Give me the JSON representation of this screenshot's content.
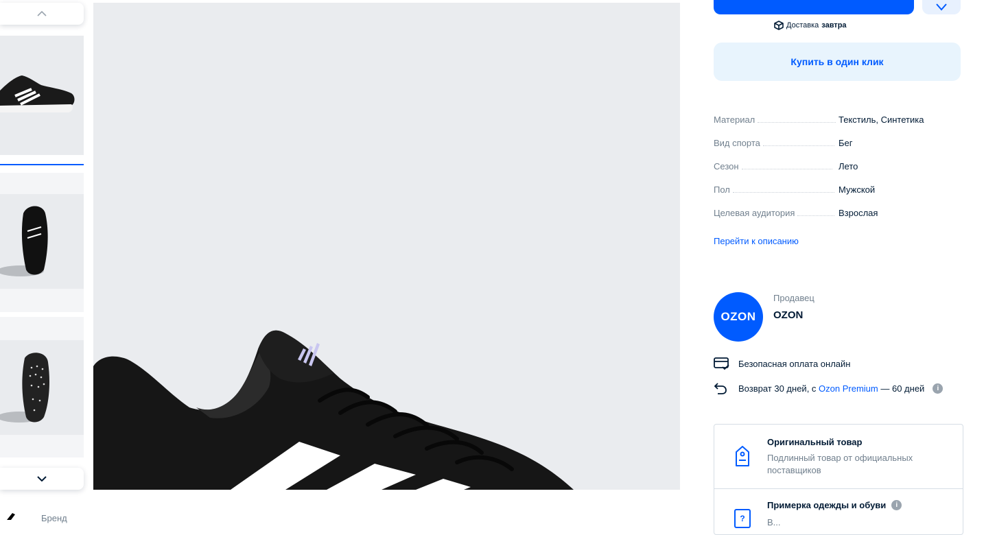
{
  "gallery": {
    "scroll_up_icon": "chevron-up-icon",
    "scroll_down_icon": "chevron-down-icon",
    "active_color": "#005bff"
  },
  "product": {
    "add_to_cart_label": "",
    "delivery_prefix": "Доставка",
    "delivery_day": "завтра",
    "buy_one_click": "Купить в один клик"
  },
  "specs": [
    {
      "name": "Материал",
      "value": "Текстиль, Синтетика"
    },
    {
      "name": "Вид спорта",
      "value": "Бег"
    },
    {
      "name": "Сезон",
      "value": "Лето"
    },
    {
      "name": "Пол",
      "value": "Мужской"
    },
    {
      "name": "Целевая аудитория",
      "value": "Взрослая"
    }
  ],
  "go_to_description": "Перейти к описанию",
  "seller": {
    "logo_text": "OZON",
    "caption": "Продавец",
    "name": "OZON"
  },
  "features": {
    "safe_payment": "Безопасная оплата онлайн",
    "return_prefix": "Возврат 30 дней, с",
    "return_link": "Ozon Premium",
    "return_suffix": "— 60 дней"
  },
  "guarantees": [
    {
      "title": "Оригинальный товар",
      "subtitle": "Подлинный товар от официальных поставщиков"
    },
    {
      "title": "Примерка одежды и обуви",
      "subtitle": "В..."
    }
  ],
  "brand_label": "Бренд",
  "colors": {
    "brand": "#005bff",
    "text": "#001a34",
    "muted": "#707f8d"
  }
}
